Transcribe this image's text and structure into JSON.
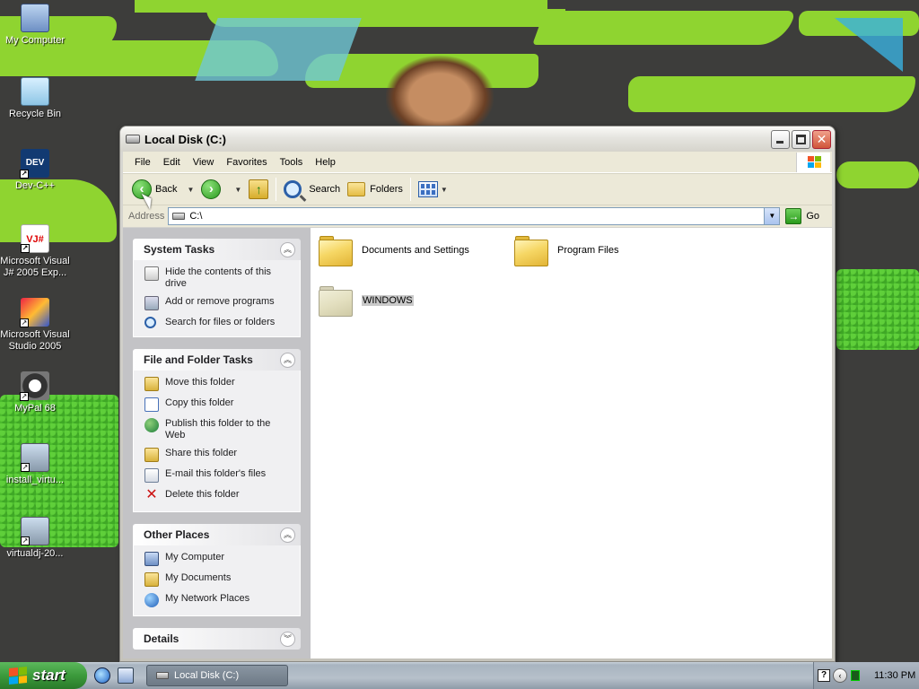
{
  "desktop": {
    "icons": [
      {
        "label": "My Computer"
      },
      {
        "label": "Recycle Bin"
      },
      {
        "label": "Dev-C++",
        "glyph": "DEV"
      },
      {
        "label": "Microsoft Visual J# 2005 Exp...",
        "glyph": "VJ#"
      },
      {
        "label": "Microsoft Visual Studio 2005"
      },
      {
        "label": "MyPal 68"
      },
      {
        "label": "install_virtu..."
      },
      {
        "label": "virtualdj-20..."
      }
    ]
  },
  "window": {
    "title": "Local Disk (C:)",
    "menu": [
      "File",
      "Edit",
      "View",
      "Favorites",
      "Tools",
      "Help"
    ],
    "toolbar": {
      "back_label": "Back",
      "search_label": "Search",
      "folders_label": "Folders"
    },
    "address": {
      "label": "Address",
      "value": "C:\\",
      "go_label": "Go"
    },
    "task_pane": {
      "system_tasks": {
        "title": "System Tasks",
        "items": [
          "Hide the contents of this drive",
          "Add or remove programs",
          "Search for files or folders"
        ]
      },
      "file_folder_tasks": {
        "title": "File and Folder Tasks",
        "items": [
          "Move this folder",
          "Copy this folder",
          "Publish this folder to the Web",
          "Share this folder",
          "E-mail this folder's files",
          "Delete this folder"
        ]
      },
      "other_places": {
        "title": "Other Places",
        "items": [
          "My Computer",
          "My Documents",
          "My Network Places"
        ]
      },
      "details": {
        "title": "Details"
      }
    },
    "files": [
      {
        "name": "Documents and Settings"
      },
      {
        "name": "Program Files"
      },
      {
        "name": "WINDOWS",
        "selected": true
      }
    ]
  },
  "taskbar": {
    "start_label": "start",
    "task_button_label": "Local Disk (C:)",
    "help_glyph": "?",
    "clock": "11:30 PM"
  }
}
